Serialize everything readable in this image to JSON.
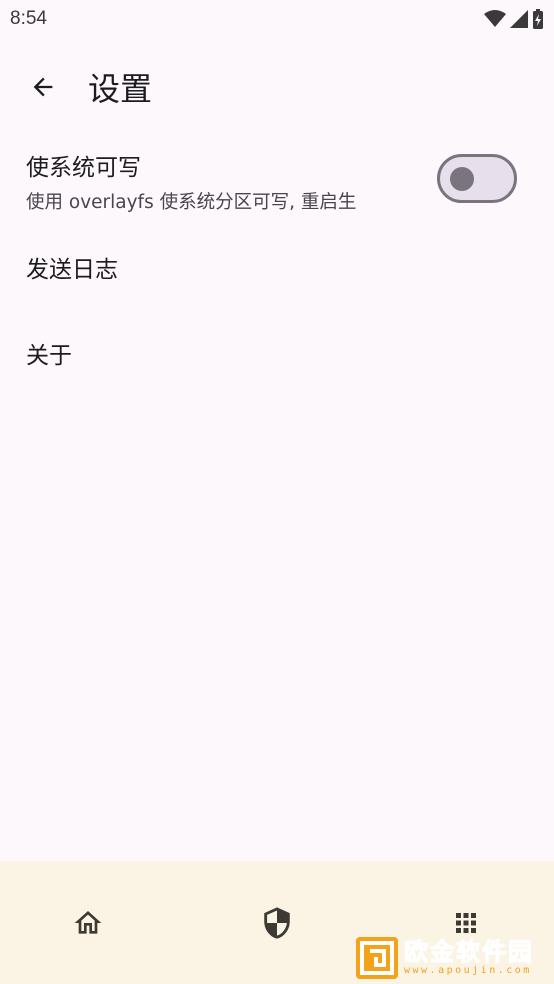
{
  "status_bar": {
    "time": "8:54"
  },
  "top_bar": {
    "title": "设置"
  },
  "settings": [
    {
      "title": "使系统可写",
      "subtitle": "使用 overlayfs 使系统分区可写, 重启生",
      "switch_on": false
    },
    {
      "title": "发送日志"
    },
    {
      "title": "关于"
    }
  ],
  "bottom_nav": {
    "items": [
      "home-icon",
      "shield-icon",
      "apps-grid-icon"
    ]
  },
  "watermark": {
    "name": "欧金软件园",
    "url": "www.apoujin.com"
  },
  "colors": {
    "background": "#fdf8fc",
    "nav_background": "#fbf4e4",
    "switch_outline": "#79747e",
    "watermark": "#f3a21a"
  }
}
